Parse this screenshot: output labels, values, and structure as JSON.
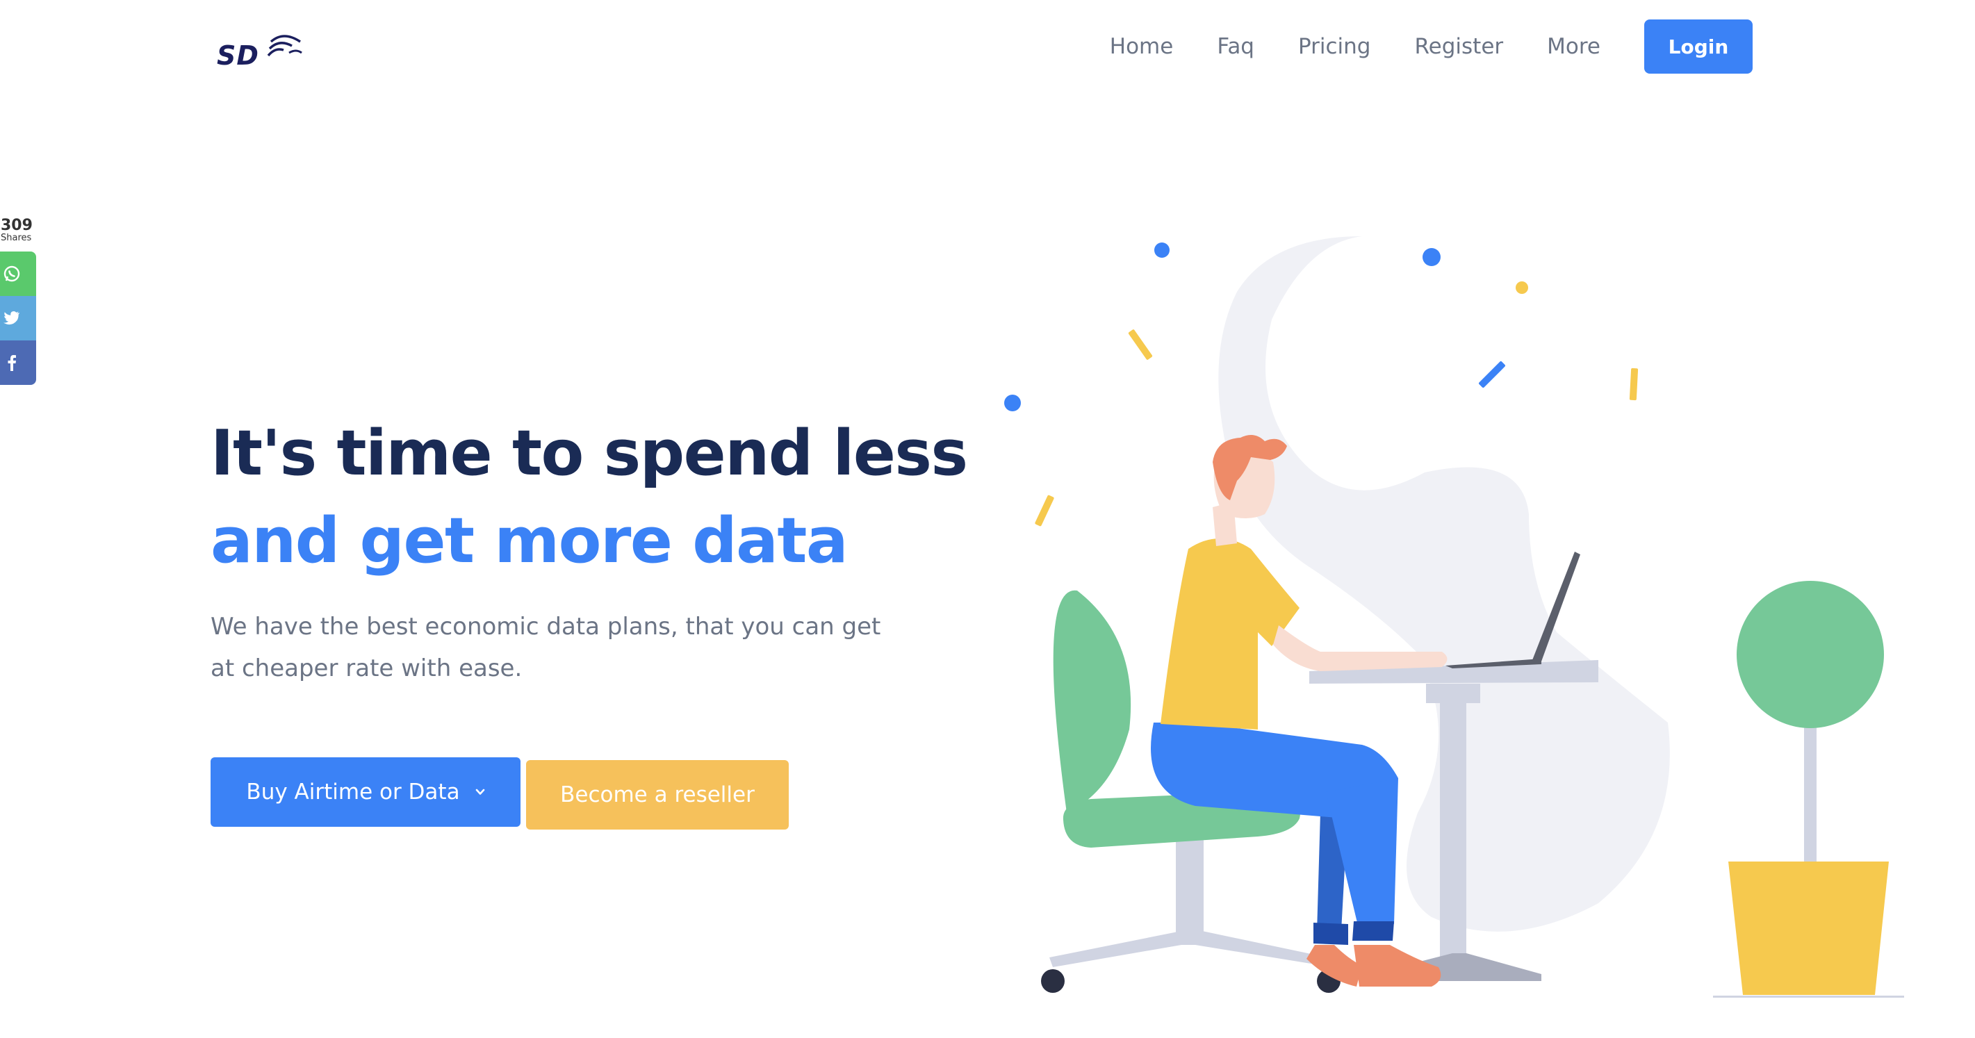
{
  "header": {
    "logo_text": "SD",
    "nav": [
      {
        "label": "Home"
      },
      {
        "label": "Faq"
      },
      {
        "label": "Pricing"
      },
      {
        "label": "Register"
      },
      {
        "label": "More"
      }
    ],
    "login_label": "Login"
  },
  "share": {
    "count": "309",
    "label": "Shares",
    "buttons": [
      {
        "network": "whatsapp",
        "icon": "whatsapp-icon",
        "color": "#5ac96c"
      },
      {
        "network": "twitter",
        "icon": "twitter-icon",
        "color": "#5ea9dd"
      },
      {
        "network": "facebook",
        "icon": "facebook-icon",
        "color": "#4d6ab4"
      }
    ]
  },
  "hero": {
    "line1": "It's time to spend less",
    "line2": "and get more data",
    "subtitle": "We have the best economic data plans, that you can get at cheaper rate with ease.",
    "buy_label": "Buy Airtime or Data",
    "reseller_label": "Become a reseller"
  },
  "colors": {
    "primary": "#3b82f6",
    "accent": "#f6c15b",
    "heading": "#1a2b55",
    "text": "#6b7485",
    "plant_green": "#76c898"
  },
  "illustration": {
    "description_icon": "person-at-desk-illustration"
  }
}
